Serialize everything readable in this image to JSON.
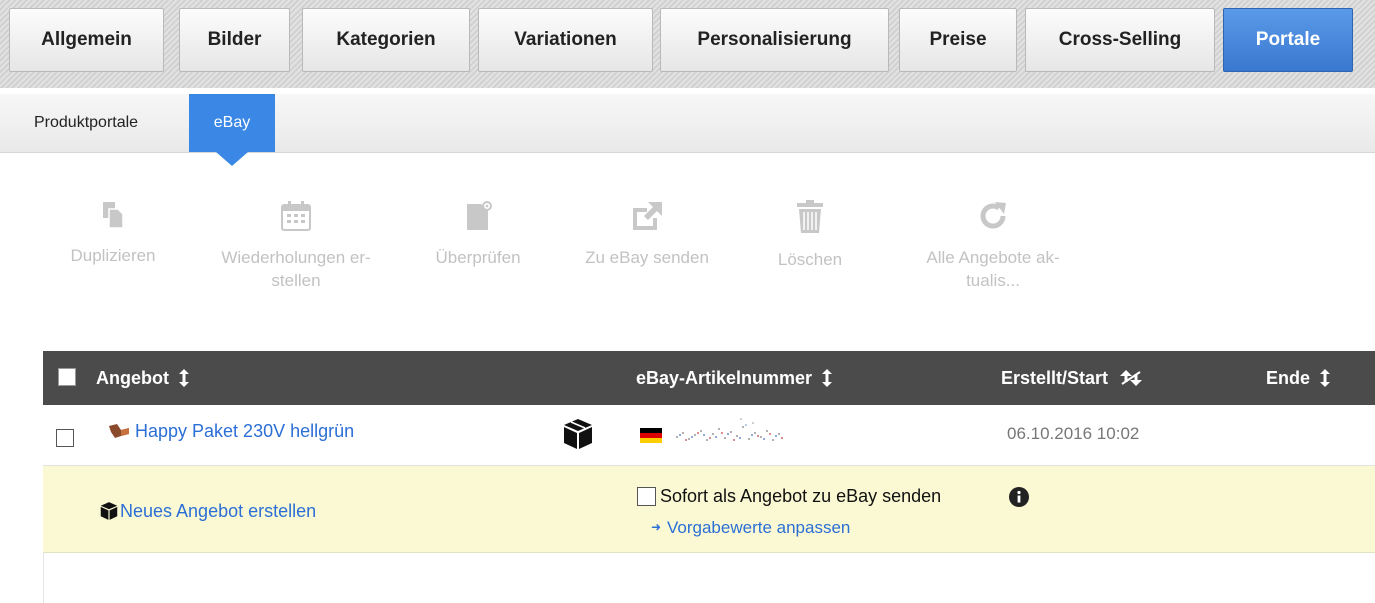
{
  "main_tabs": [
    {
      "label": "Allgemein"
    },
    {
      "label": "Bilder"
    },
    {
      "label": "Kategorien"
    },
    {
      "label": "Variationen"
    },
    {
      "label": "Personalisierung"
    },
    {
      "label": "Preise"
    },
    {
      "label": "Cross-Selling"
    },
    {
      "label": "Portale",
      "active": true
    }
  ],
  "sub_tabs": [
    {
      "label": "Produktportale"
    },
    {
      "label": "eBay",
      "active": true
    }
  ],
  "toolbar": {
    "duplicate": {
      "line1": "Duplizieren",
      "line2": "",
      "icon": "duplicate-icon"
    },
    "repeat": {
      "line1": "Wiederholungen er-",
      "line2": "stellen",
      "icon": "calendar-icon"
    },
    "check": {
      "line1": "Überprüfen",
      "line2": "",
      "icon": "document-gear-icon"
    },
    "send": {
      "line1": "Zu eBay senden",
      "line2": "",
      "icon": "external-link-icon"
    },
    "delete": {
      "line1": "Löschen",
      "line2": "",
      "icon": "trash-icon"
    },
    "refresh": {
      "line1": "Alle Angebote ak-",
      "line2": "tualis...",
      "icon": "refresh-icon"
    }
  },
  "table": {
    "headers": {
      "offer": "Angebot",
      "item_number": "eBay-Artikelnummer",
      "created": "Erstellt/Start",
      "end": "Ende"
    },
    "rows": [
      {
        "title": "Happy Paket 230V hellgrün",
        "country_flag": "germany-flag-icon",
        "created": "06.10.2016 10:02",
        "end": ""
      }
    ],
    "new_offer": {
      "label": "Neues Angebot erstellen",
      "send_checkbox_label": "Sofort als Angebot zu eBay senden",
      "defaults_link": "Vorgabewerte anpassen"
    }
  },
  "colors": {
    "accent": "#3a87e6",
    "link": "#2b6fd6",
    "header_bg": "#4b4b4b",
    "new_row_bg": "#fbf9d3",
    "disabled_text": "#c2c2c2"
  }
}
